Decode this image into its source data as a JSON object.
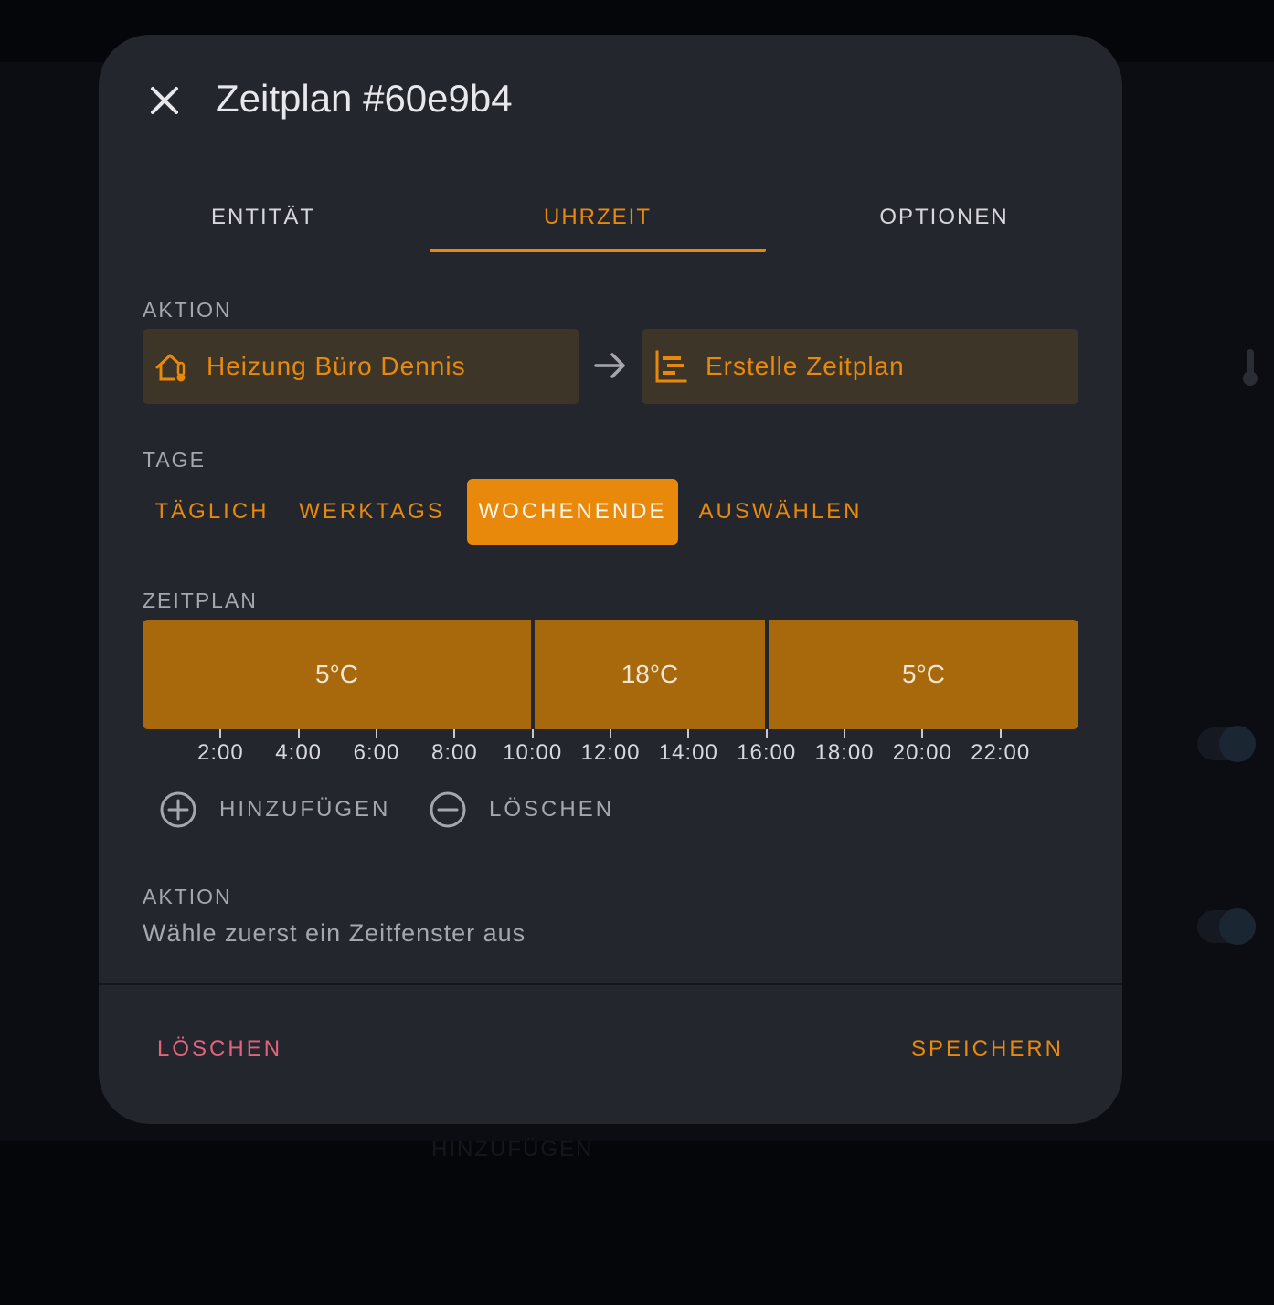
{
  "dialog": {
    "title": "Zeitplan #60e9b4",
    "close_icon": "close-icon"
  },
  "tabs": [
    {
      "label": "ENTITÄT",
      "active": false
    },
    {
      "label": "UHRZEIT",
      "active": true
    },
    {
      "label": "OPTIONEN",
      "active": false
    }
  ],
  "action": {
    "label": "AKTION",
    "entity": {
      "icon": "home-thermometer-icon",
      "text": "Heizung Büro Dennis"
    },
    "arrow_icon": "arrow-right-icon",
    "service": {
      "icon": "calendar-schedule-icon",
      "text": "Erstelle Zeitplan"
    }
  },
  "days": {
    "label": "TAGE",
    "options": [
      "TÄGLICH",
      "WERKTAGS",
      "WOCHENENDE",
      "AUSWÄHLEN"
    ],
    "selected": "WOCHENENDE"
  },
  "schedule": {
    "label": "ZEITPLAN",
    "slots": [
      {
        "start": "00:00",
        "end": "10:00",
        "value": "5°C"
      },
      {
        "start": "10:00",
        "end": "16:00",
        "value": "18°C"
      },
      {
        "start": "16:00",
        "end": "24:00",
        "value": "5°C"
      }
    ],
    "ticks": [
      "2:00",
      "4:00",
      "6:00",
      "8:00",
      "10:00",
      "12:00",
      "14:00",
      "16:00",
      "18:00",
      "20:00",
      "22:00"
    ],
    "add_label": "HINZUFÜGEN",
    "delete_label": "LÖSCHEN"
  },
  "slot_action": {
    "label": "AKTION",
    "hint": "Wähle zuerst ein Zeitfenster aus"
  },
  "footer": {
    "delete_label": "LÖSCHEN",
    "save_label": "SPEICHERN"
  },
  "background": {
    "label": "HINZUFÜGEN"
  },
  "colors": {
    "accent": "#e8890c",
    "danger": "#e5627c",
    "dialog_bg": "#24262e",
    "slot_bg": "#a8690c"
  }
}
